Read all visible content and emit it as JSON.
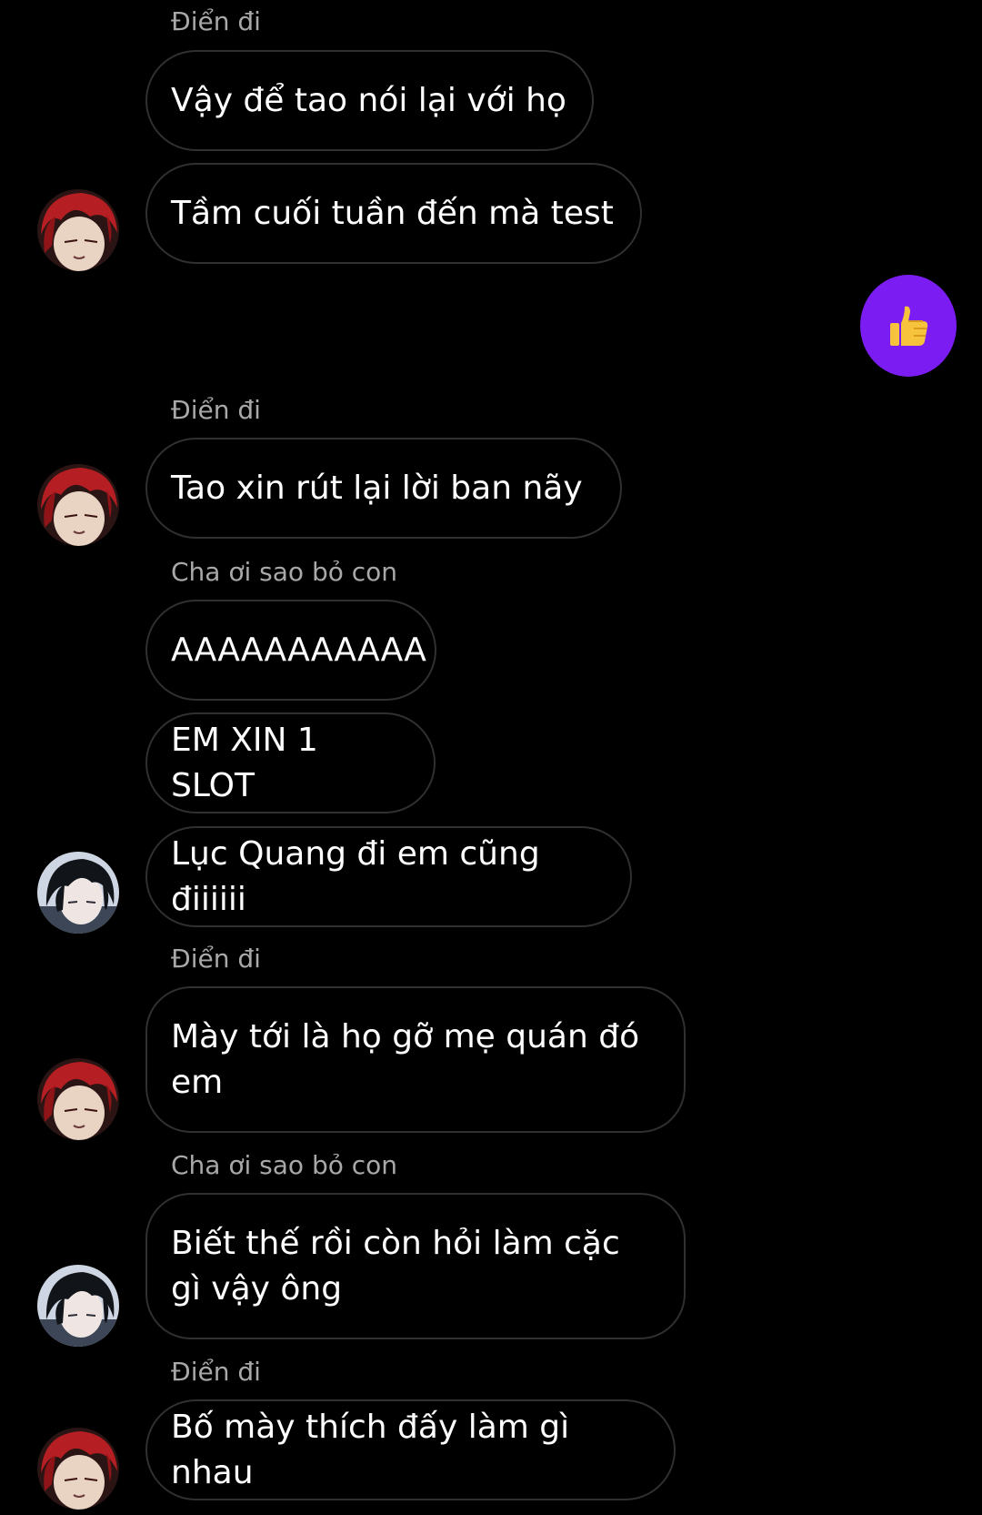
{
  "colors": {
    "background": "#000000",
    "bubble_border": "#303030",
    "sender_name": "#a8a8a8",
    "accent_like": "#7b1df2"
  },
  "icons": {
    "like": "thumbs-up-icon",
    "avatar_a": "red-hair-anime-avatar",
    "avatar_b": "dark-hair-anime-avatar"
  },
  "messages": [
    {
      "sender": "Điển đi"
    },
    {
      "text": "Vậy để tao nói lại với họ"
    },
    {
      "text": "Tầm cuối tuần đến mà test"
    },
    {
      "sender": "Điển đi"
    },
    {
      "text": "Tao xin rút lại lời ban nãy"
    },
    {
      "sender": "Cha ơi sao bỏ con"
    },
    {
      "text": "AAAAAAAAAAA"
    },
    {
      "text": "EM XIN 1 SLOT"
    },
    {
      "text": "Lục Quang đi em cũng điiiiii"
    },
    {
      "sender": "Điển đi"
    },
    {
      "text": "Mày tới là họ gỡ mẹ quán đó em"
    },
    {
      "sender": "Cha ơi sao bỏ con"
    },
    {
      "text": "Biết thế rồi còn hỏi làm cặc gì vậy ông"
    },
    {
      "sender": "Điển đi"
    },
    {
      "text": "Bố mày thích đấy làm gì nhau"
    }
  ]
}
